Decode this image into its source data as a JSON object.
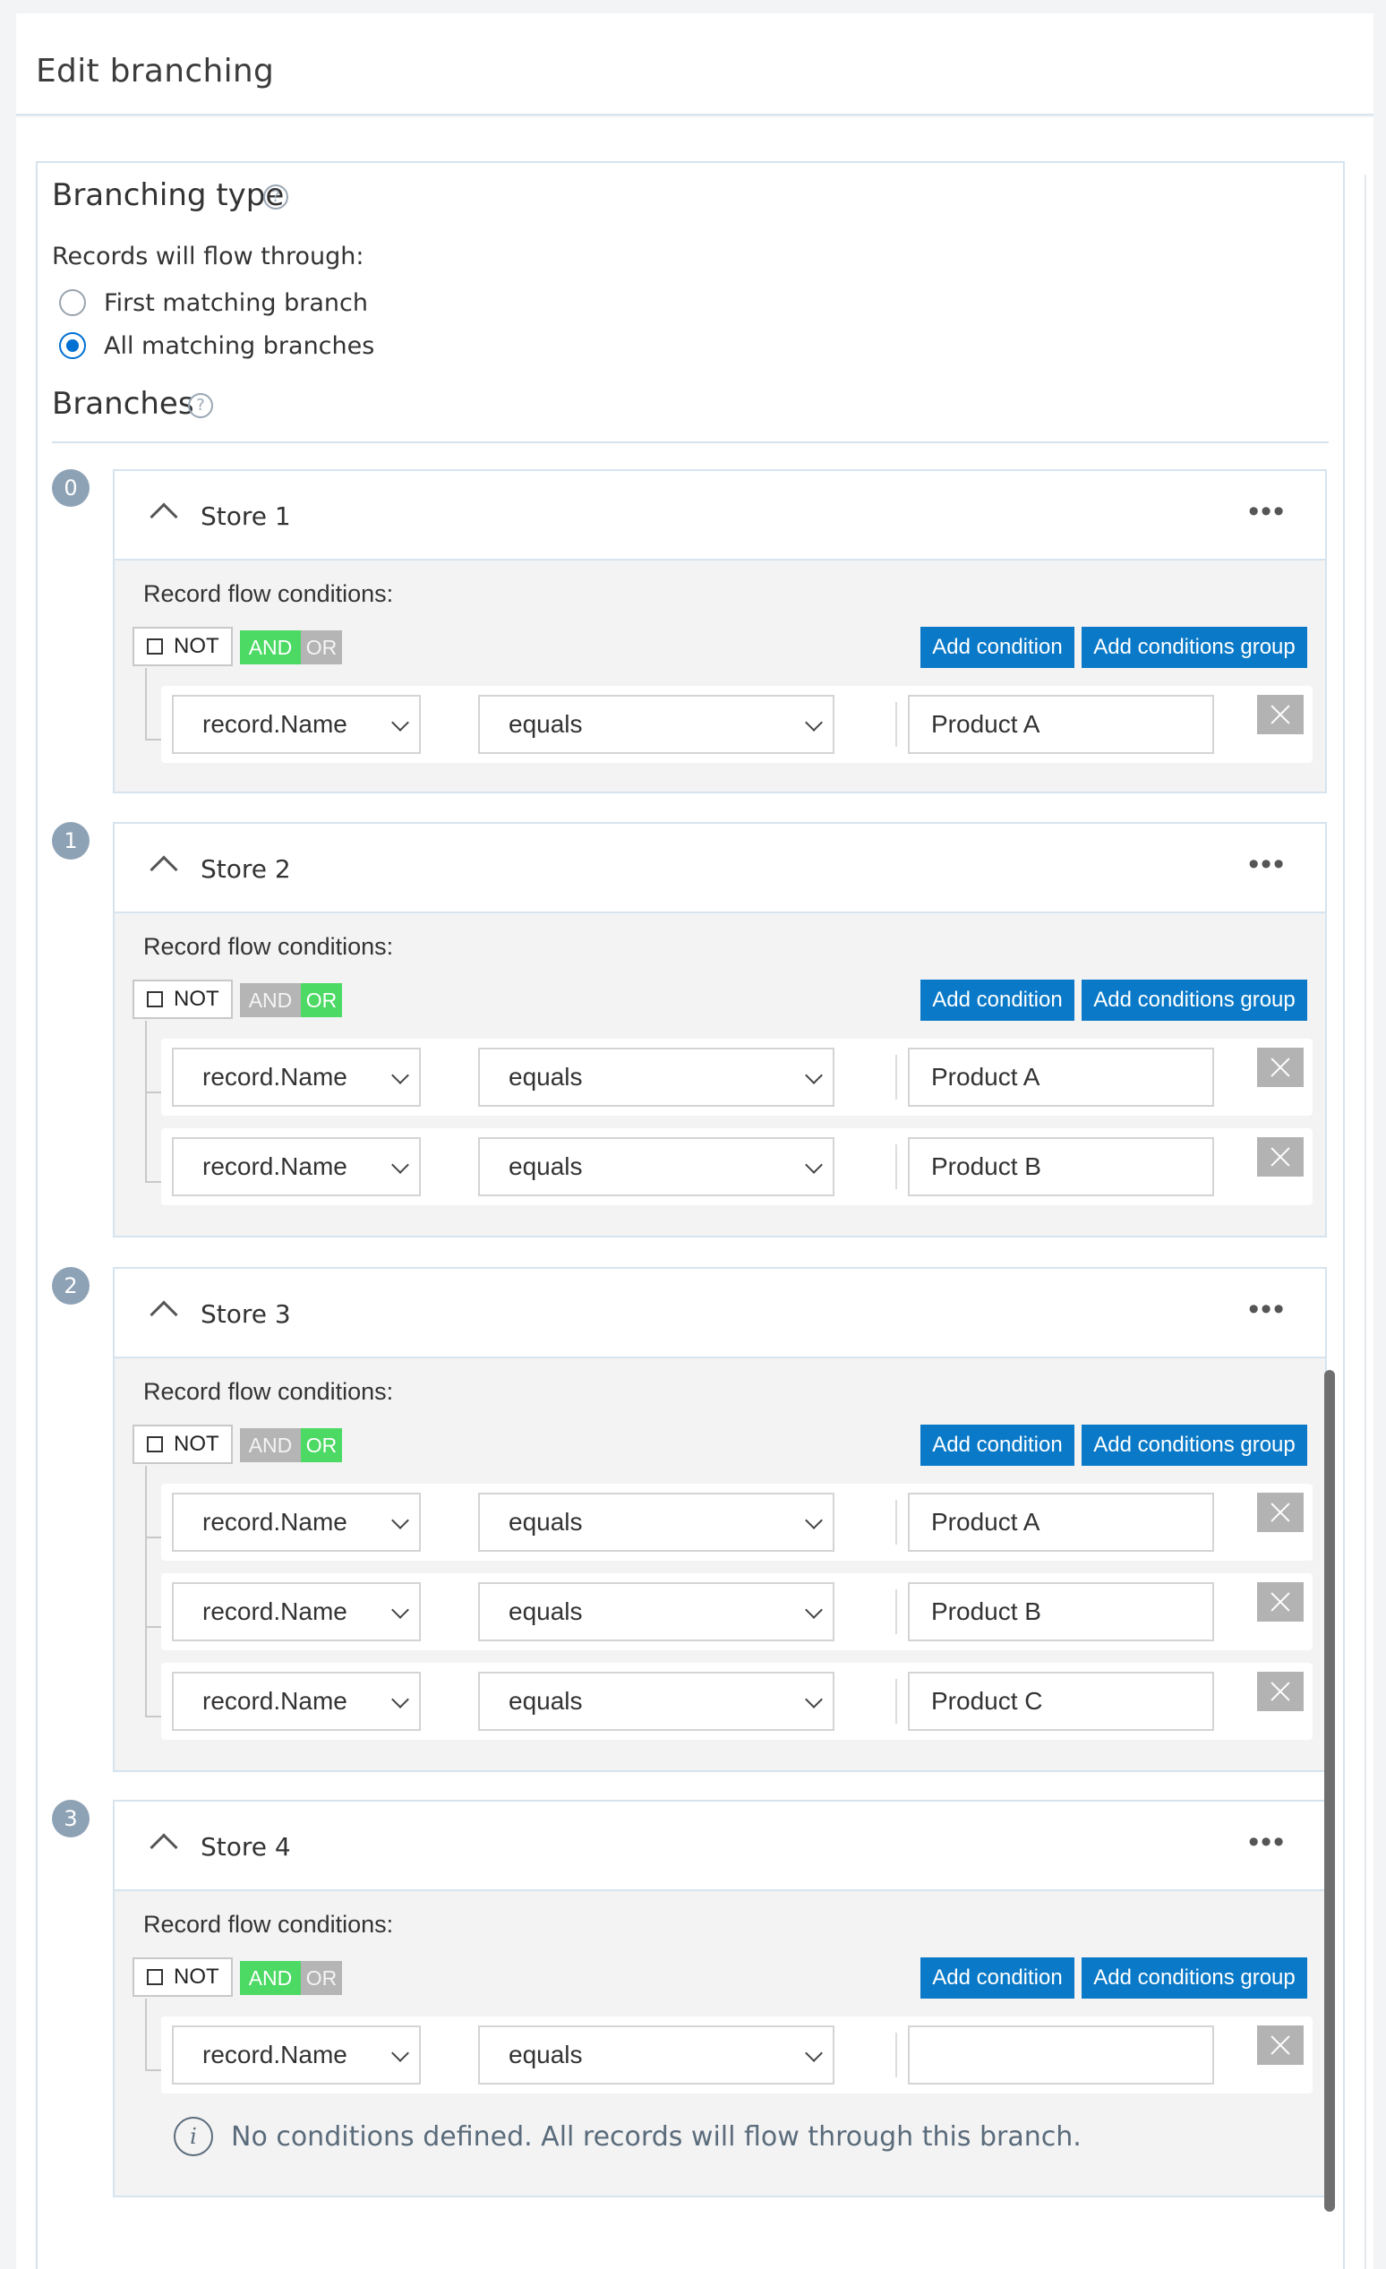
{
  "header": {
    "title": "Edit branching"
  },
  "branching_type": {
    "title": "Branching type",
    "help_icon": "question-circle-icon",
    "flow_label": "Records will flow through:",
    "options": [
      {
        "label": "First matching branch",
        "selected": false
      },
      {
        "label": "All matching branches",
        "selected": true
      }
    ]
  },
  "branches_section": {
    "title": "Branches",
    "help_icon": "question-circle-icon"
  },
  "branches": [
    {
      "index": "0",
      "name": "Store 1",
      "conditions_label": "Record flow conditions:",
      "not_label": "NOT",
      "and_label": "AND",
      "or_label": "OR",
      "active_logic": "AND",
      "add_condition_label": "Add condition",
      "add_group_label": "Add conditions group",
      "conditions": [
        {
          "field": "record.Name",
          "operator": "equals",
          "value": "Product A"
        }
      ]
    },
    {
      "index": "1",
      "name": "Store 2",
      "conditions_label": "Record flow conditions:",
      "not_label": "NOT",
      "and_label": "AND",
      "or_label": "OR",
      "active_logic": "OR",
      "add_condition_label": "Add condition",
      "add_group_label": "Add conditions group",
      "conditions": [
        {
          "field": "record.Name",
          "operator": "equals",
          "value": "Product A"
        },
        {
          "field": "record.Name",
          "operator": "equals",
          "value": "Product B"
        }
      ]
    },
    {
      "index": "2",
      "name": "Store 3",
      "conditions_label": "Record flow conditions:",
      "not_label": "NOT",
      "and_label": "AND",
      "or_label": "OR",
      "active_logic": "OR",
      "add_condition_label": "Add condition",
      "add_group_label": "Add conditions group",
      "conditions": [
        {
          "field": "record.Name",
          "operator": "equals",
          "value": "Product A"
        },
        {
          "field": "record.Name",
          "operator": "equals",
          "value": "Product B"
        },
        {
          "field": "record.Name",
          "operator": "equals",
          "value": "Product C"
        }
      ]
    },
    {
      "index": "3",
      "name": "Store 4",
      "conditions_label": "Record flow conditions:",
      "not_label": "NOT",
      "and_label": "AND",
      "or_label": "OR",
      "active_logic": "AND",
      "add_condition_label": "Add condition",
      "add_group_label": "Add conditions group",
      "conditions": [
        {
          "field": "record.Name",
          "operator": "equals",
          "value": ""
        }
      ],
      "info_icon": "info-circle-icon",
      "info_text": "No conditions defined. All records will flow through this branch."
    }
  ],
  "colors": {
    "primary_button": "#0a7ac8",
    "logic_active": "#4cd964",
    "logic_inactive": "#b5b5b5",
    "badge": "#8ea2b6"
  }
}
